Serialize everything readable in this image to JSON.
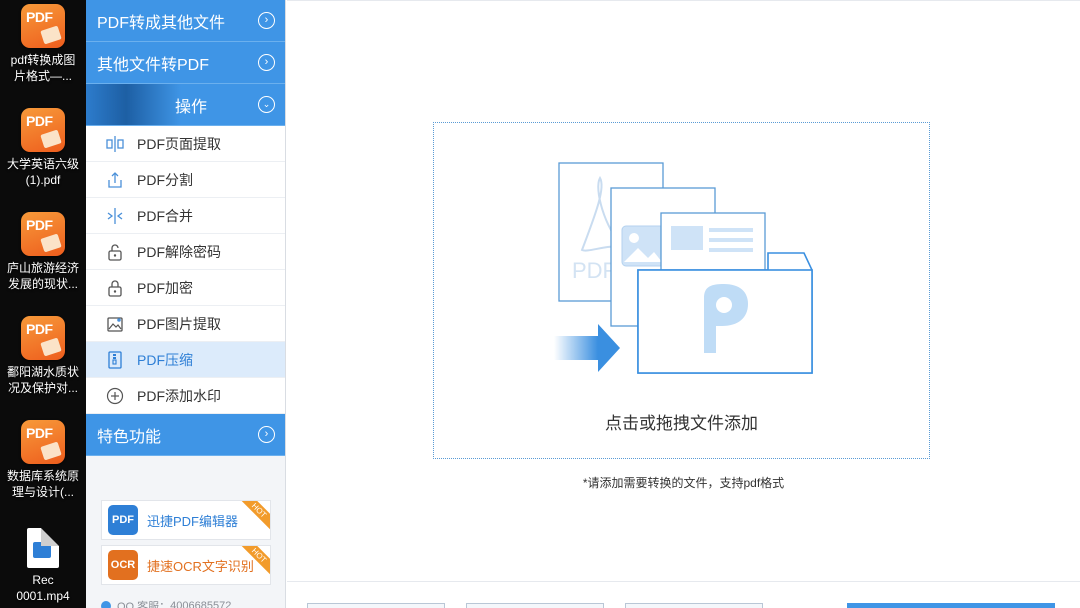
{
  "desktop": {
    "items": [
      {
        "icon": "pdf-app-icon",
        "label": "pdf转换成图\n片格式—..."
      },
      {
        "icon": "pdf-app-icon",
        "label": "大学英语六级\n(1).pdf"
      },
      {
        "icon": "pdf-app-icon",
        "label": "庐山旅游经济\n发展的现状..."
      },
      {
        "icon": "pdf-app-icon",
        "label": "鄱阳湖水质状\n况及保护对..."
      },
      {
        "icon": "pdf-app-icon",
        "label": "数据库系统原\n理与设计(..."
      },
      {
        "icon": "mp4-file-icon",
        "label": "Rec\n0001.mp4"
      }
    ],
    "icon_text": "PDF"
  },
  "sidebar": {
    "categories": [
      {
        "label": "PDF转成其他文件",
        "icon": "chevron-right-circle-icon"
      },
      {
        "label": "其他文件转PDF",
        "icon": "chevron-right-circle-icon"
      },
      {
        "label": "操作",
        "icon": "chevron-down-circle-icon"
      }
    ],
    "operations": [
      {
        "label": "PDF页面提取",
        "icon": "page-extract-icon"
      },
      {
        "label": "PDF分割",
        "icon": "split-upload-icon"
      },
      {
        "label": "PDF合并",
        "icon": "merge-icon"
      },
      {
        "label": "PDF解除密码",
        "icon": "unlock-icon"
      },
      {
        "label": "PDF加密",
        "icon": "lock-icon"
      },
      {
        "label": "PDF图片提取",
        "icon": "image-extract-icon"
      },
      {
        "label": "PDF压缩",
        "icon": "compress-icon",
        "active": true
      },
      {
        "label": "PDF添加水印",
        "icon": "watermark-icon"
      }
    ],
    "features": {
      "label": "特色功能",
      "icon": "chevron-right-circle-icon"
    },
    "promos": [
      {
        "label": "迅捷PDF编辑器",
        "logo_text": "PDF",
        "badge": "HOT",
        "color": "#2e7fd6"
      },
      {
        "label": "捷速OCR文字识别",
        "logo_text": "OCR",
        "badge": "HOT",
        "color": "#e2701f"
      }
    ],
    "qq_support": {
      "label": "QQ 客服：",
      "number": "4006685572"
    }
  },
  "main": {
    "drop_zone": {
      "text": "点击或拖拽文件添加",
      "illustration_text": "PDF"
    },
    "hint": "*请添加需要转换的文件，支持pdf格式"
  },
  "colors": {
    "accent": "#3f95e6",
    "active_bg": "#dcebfb",
    "dotted_border": "#5a9bd5"
  }
}
